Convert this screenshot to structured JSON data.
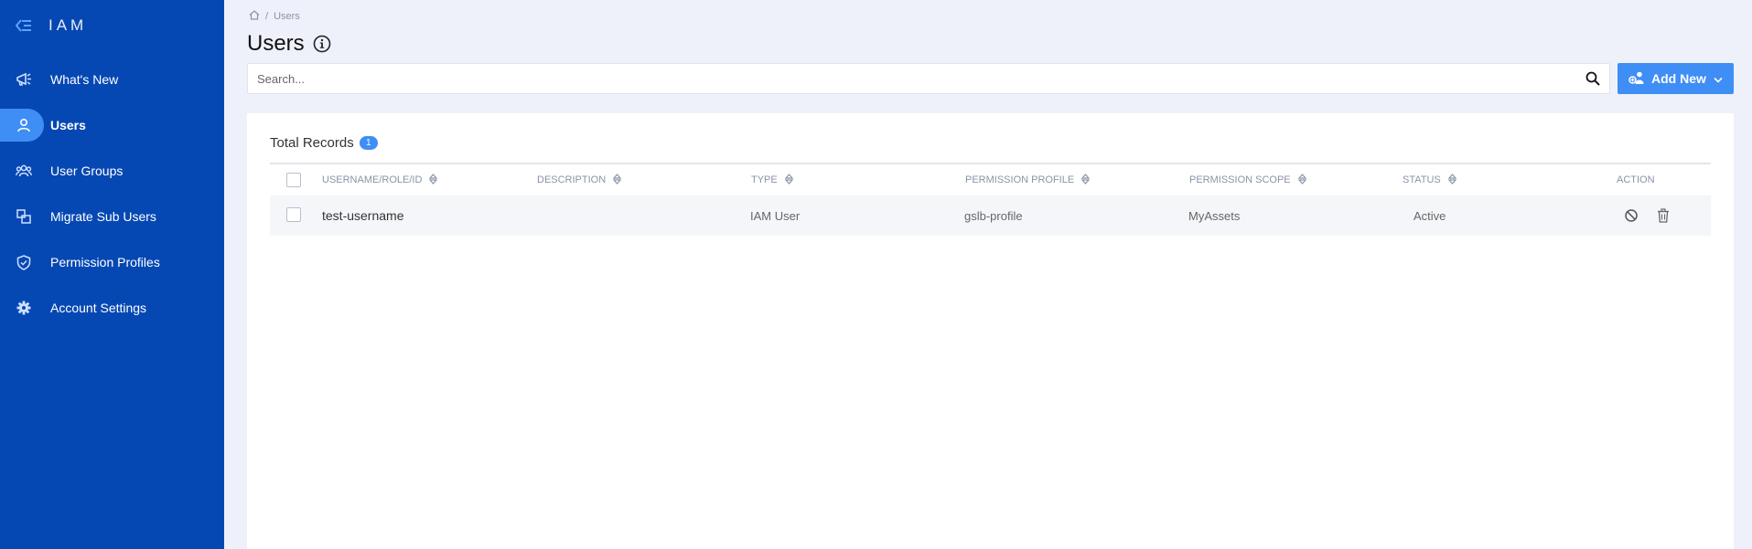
{
  "app": {
    "title": "IAM"
  },
  "sidebar": {
    "items": [
      {
        "label": "What's New",
        "icon": "megaphone-icon",
        "active": false
      },
      {
        "label": "Users",
        "icon": "user-icon",
        "active": true
      },
      {
        "label": "User Groups",
        "icon": "user-group-icon",
        "active": false
      },
      {
        "label": "Migrate Sub Users",
        "icon": "migrate-icon",
        "active": false
      },
      {
        "label": "Permission Profiles",
        "icon": "shield-check-icon",
        "active": false
      },
      {
        "label": "Account Settings",
        "icon": "gear-icon",
        "active": false
      }
    ]
  },
  "breadcrumb": {
    "current": "Users",
    "separator": "/"
  },
  "page": {
    "title": "Users"
  },
  "search": {
    "placeholder": "Search...",
    "value": ""
  },
  "toolbar": {
    "add_label": "Add New"
  },
  "records": {
    "label": "Total Records",
    "count": "1"
  },
  "table": {
    "columns": [
      "USERNAME/ROLE/ID",
      "DESCRIPTION",
      "TYPE",
      "PERMISSION PROFILE",
      "PERMISSION SCOPE",
      "STATUS",
      "ACTION"
    ],
    "rows": [
      {
        "username": "test-username",
        "description": "",
        "type": "IAM User",
        "profile": "gslb-profile",
        "scope": "MyAssets",
        "status": "Active"
      }
    ]
  },
  "colors": {
    "sidebar_bg": "#0648b3",
    "accent": "#3f8ef5",
    "page_bg": "#eef1f9"
  }
}
